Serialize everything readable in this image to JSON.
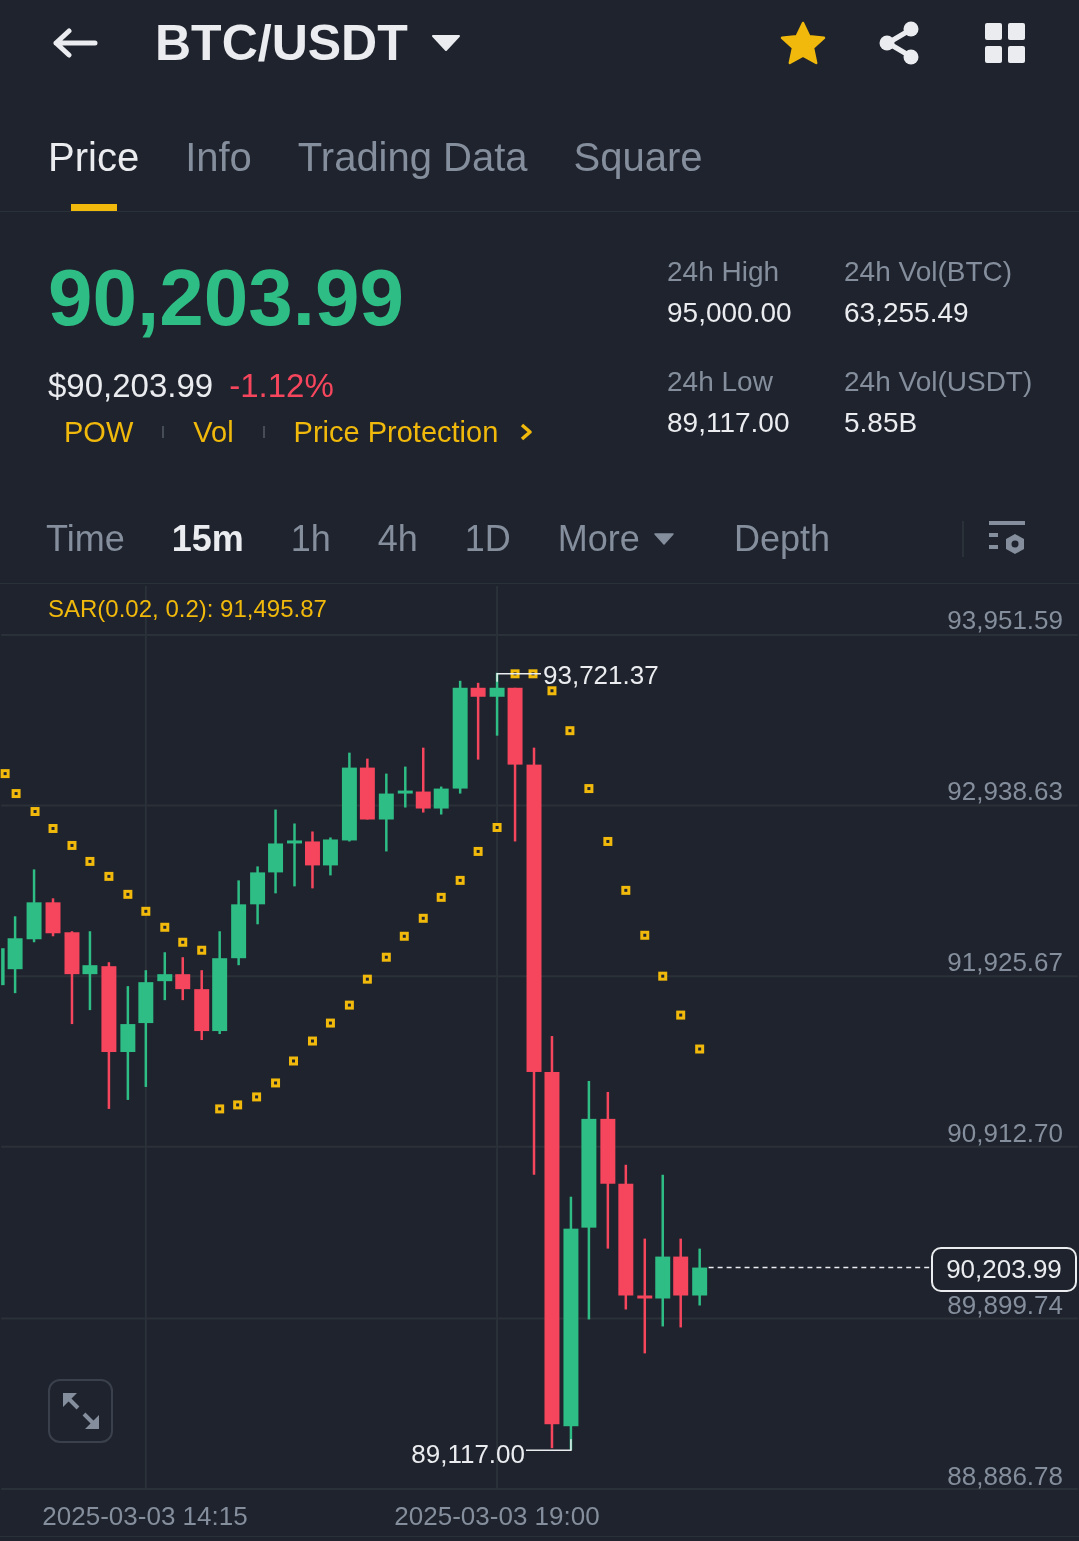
{
  "header": {
    "title": "BTC/USDT",
    "favorited": true
  },
  "tabs": [
    {
      "label": "Price",
      "selected": true
    },
    {
      "label": "Info",
      "selected": false
    },
    {
      "label": "Trading Data",
      "selected": false
    },
    {
      "label": "Square",
      "selected": false
    }
  ],
  "ticker": {
    "last_price": "90,203.99",
    "usd_price": "$90,203.99",
    "change": "-1.12%"
  },
  "tags": [
    {
      "label": "POW",
      "kind": "tag"
    },
    {
      "label": "Vol",
      "kind": "tag"
    },
    {
      "label": "Price Protection",
      "kind": "link"
    }
  ],
  "stats": [
    {
      "label": "24h High",
      "value": "95,000.00"
    },
    {
      "label": "24h Vol(BTC)",
      "value": "63,255.49"
    },
    {
      "label": "24h Low",
      "value": "89,117.00"
    },
    {
      "label": "24h Vol(USDT)",
      "value": "5.85B"
    }
  ],
  "intervals": [
    {
      "label": "Time",
      "kind": "interval",
      "selected": false
    },
    {
      "label": "15m",
      "kind": "interval",
      "selected": true
    },
    {
      "label": "1h",
      "kind": "interval",
      "selected": false
    },
    {
      "label": "4h",
      "kind": "interval",
      "selected": false
    },
    {
      "label": "1D",
      "kind": "interval",
      "selected": false
    },
    {
      "label": "More",
      "kind": "menu",
      "selected": false
    },
    {
      "label": "Depth",
      "kind": "view",
      "selected": false
    }
  ],
  "chart": {
    "indicator": "SAR(0.02, 0.2): 91,495.87",
    "y_labels": [
      "93,951.59",
      "92,938.63",
      "91,925.67",
      "90,912.70",
      "89,899.74",
      "88,886.78"
    ],
    "high_label": "93,721.37",
    "low_label": "89,117.00",
    "last_price": "90,203.99",
    "x_labels": [
      "2025-03-03 14:15",
      "2025-03-03 19:00"
    ]
  }
}
